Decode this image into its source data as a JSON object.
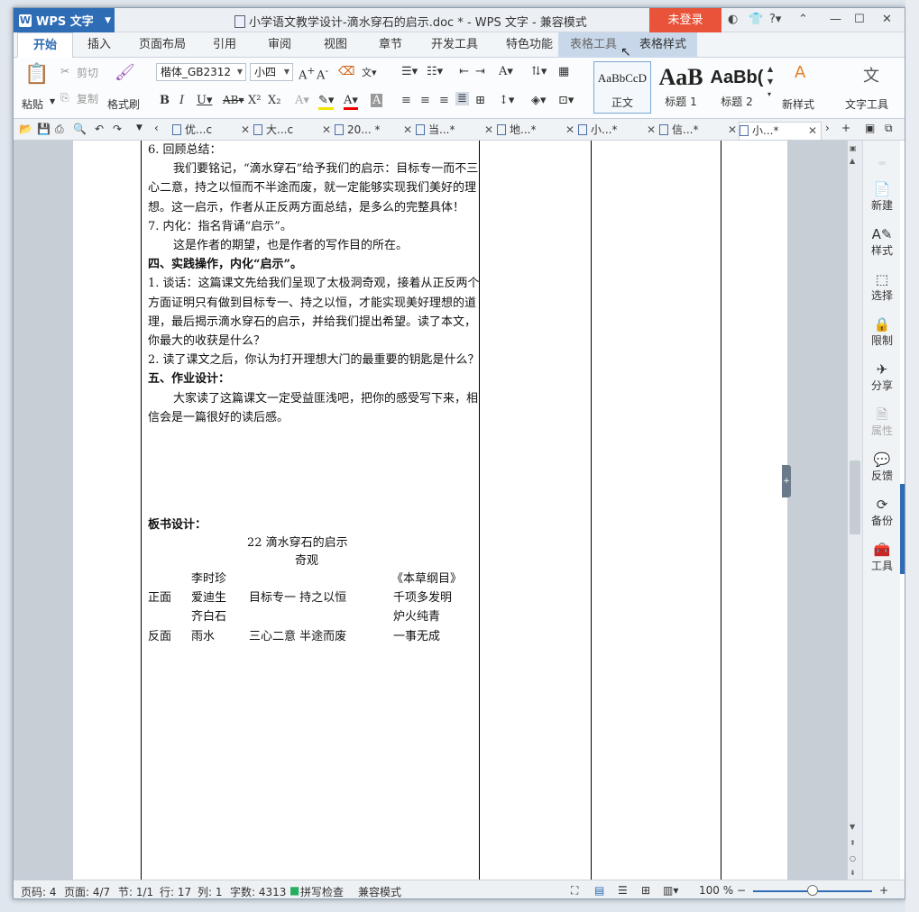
{
  "titlebar": {
    "app_name": "WPS 文字",
    "doc_title": "小学语文教学设计-滴水穿石的启示.doc * - WPS 文字 - 兼容模式",
    "login_label": "未登录"
  },
  "tabs": [
    "开始",
    "插入",
    "页面布局",
    "引用",
    "审阅",
    "视图",
    "章节",
    "开发工具",
    "特色功能",
    "表格工具",
    "表格样式"
  ],
  "ribbon": {
    "paste": "粘贴",
    "cut": "剪切",
    "copy": "复制",
    "format_painter": "格式刷",
    "font_name": "楷体_GB2312",
    "font_size": "小四",
    "styles": [
      {
        "preview": "AaBbCcD",
        "label": "正文"
      },
      {
        "preview": "AaB",
        "label": "标题 1"
      },
      {
        "preview": "AaBb(",
        "label": "标题 2"
      }
    ],
    "new_style": "新样式",
    "text_tools": "文字工具"
  },
  "doc_tabs": [
    "优...c",
    "大...c",
    "20... *",
    "当...*",
    "地...*",
    "小...*",
    "信...*",
    "小...*"
  ],
  "document": {
    "lines": [
      "6. 回顾总结：",
      "我们要铭记，“滴水穿石”给予我们的启示：目标专一而不三心二意，持之以恒而不半途而废，就一定能够实现我们美好的理想。这一启示，作者从正反两方面总结，是多么的完整具体！",
      "7. 内化：指名背诵“启示”。",
      "这是作者的期望，也是作者的写作目的所在。",
      "四、实践操作，内化“启示”。",
      "1. 谈话：这篇课文先给我们呈现了太极洞奇观，接着从正反两个方面证明只有做到目标专一、持之以恒，才能实现美好理想的道理，最后揭示滴水穿石的启示，并给我们提出希望。读了本文，你最大的收获是什么？",
      "2. 读了课文之后，你认为打开理想大门的最重要的钥匙是什么？",
      "五、作业设计：",
      "大家读了这篇课文一定受益匪浅吧，把你的感受写下来，相信会是一篇很好的读后感。"
    ],
    "board": {
      "heading": "板书设计：",
      "title": "22  滴水穿石的启示",
      "subtitle": "奇观",
      "names": [
        "李时珍",
        "爱迪生",
        "齐白石"
      ],
      "positive_label": "正面",
      "positive_mid": "目标专一  持之以恒",
      "right_items": [
        "《本草纲目》",
        "千项多发明",
        "炉火纯青"
      ],
      "negative_label": "反面",
      "negative_example": "雨水",
      "negative_mid": "三心二意   半途而废",
      "negative_right": "一事无成"
    }
  },
  "side_panel": [
    "新建",
    "样式",
    "选择",
    "限制",
    "分享",
    "属性",
    "反馈",
    "备份",
    "工具"
  ],
  "status": {
    "page_code": "页码: 4",
    "pages": "页面: 4/7",
    "section": "节: 1/1",
    "row": "行: 17",
    "col": "列: 1",
    "words": "字数: 4313",
    "spell": "拼写检查",
    "mode": "兼容模式",
    "zoom": "100 %"
  },
  "colors": {
    "accent": "#2e6cb5",
    "login": "#e8533a"
  }
}
